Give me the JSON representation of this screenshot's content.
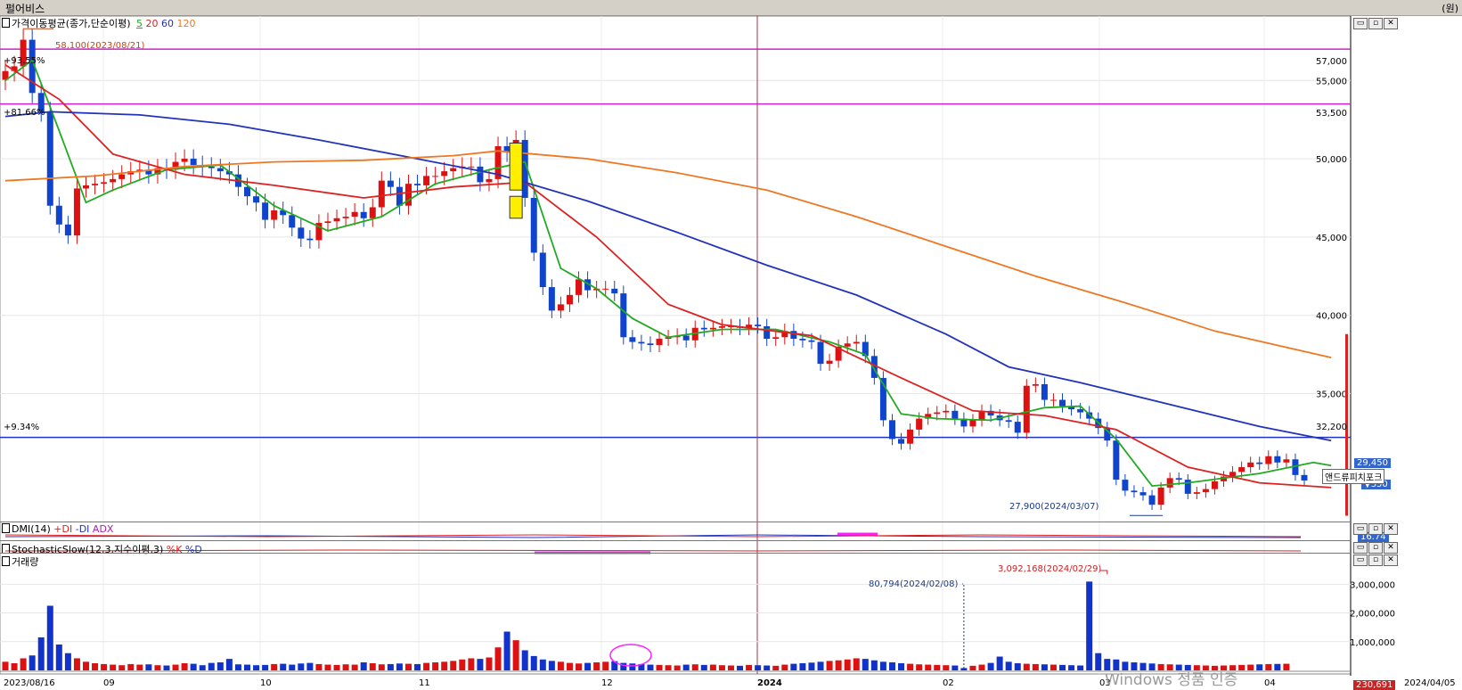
{
  "window": {
    "title": "펄어비스",
    "unit": "(원)"
  },
  "price_panel": {
    "legend_prefix": "가격이동평균(종가,단순이평)",
    "legend_ma": [
      {
        "label": "5",
        "color": "#22aa22"
      },
      {
        "label": "20",
        "color": "#dd2222"
      },
      {
        "label": "60",
        "color": "#2233bb"
      },
      {
        "label": "120",
        "color": "#ee7722"
      }
    ],
    "high_note": "58,100(2023/08/21)",
    "low_note": "27,900(2024/03/07)",
    "pct_labels": [
      "+93.55%",
      "+81.66%",
      "+9.34%"
    ],
    "hline_labels": [
      "57,000",
      "53,500",
      "32,200"
    ],
    "current_price": "29,450",
    "current_change": "▼350",
    "pitchfork_label": "앤드류피치포크"
  },
  "dmi_panel": {
    "title": "DMI(14)",
    "legend": [
      "+DI",
      "-DI",
      "ADX"
    ],
    "value": "16.74"
  },
  "stoch_panel": {
    "title": "StochasticSlow(12,3,지수이평,3)",
    "legend": [
      "%K",
      "%D"
    ]
  },
  "volume_panel": {
    "title": "거래량",
    "peak_note": "3,092,168(2024/02/29)",
    "low_note": "80,794(2024/02/08)",
    "current": "230,691"
  },
  "x_axis_labels": [
    "2023/08/16",
    "09",
    "10",
    "11",
    "12",
    "2024",
    "02",
    "03",
    "04",
    "2024/04/05"
  ],
  "watermark": "Windows 정품 인증",
  "chart_data": [
    {
      "type": "candlestick",
      "title": "가격이동평균(종가,단순이평)",
      "ylim": [
        27000,
        59000
      ],
      "y_ticks": [
        35000,
        40000,
        45000,
        50000,
        55000
      ],
      "y_tick_labels": [
        "35,000",
        "40,000",
        "45,000",
        "50,000",
        "55,000"
      ],
      "hlines": [
        57000,
        53500,
        32200
      ],
      "vline_date": "2024/01/02",
      "close": [
        55600,
        55900,
        57600,
        54200,
        53000,
        47000,
        45800,
        45100,
        48100,
        48300,
        48400,
        48500,
        48700,
        49000,
        49200,
        49300,
        49000,
        49400,
        49300,
        49800,
        50000,
        49600,
        49500,
        49400,
        49200,
        49000,
        48200,
        47600,
        47200,
        46100,
        46700,
        46400,
        45600,
        44900,
        44800,
        45900,
        46000,
        46200,
        46300,
        46600,
        46200,
        46900,
        48600,
        48200,
        47000,
        48400,
        48300,
        48900,
        48900,
        49200,
        49400,
        49500,
        49500,
        48500,
        48700,
        50800,
        50400,
        51200,
        47500,
        44000,
        41800,
        40300,
        40700,
        41300,
        42300,
        41600,
        41700,
        41700,
        41400,
        38600,
        38300,
        38200,
        38100,
        38500,
        38600,
        38700,
        38400,
        39200,
        39100,
        39200,
        39300,
        39300,
        39200,
        39400,
        39300,
        38500,
        38600,
        39000,
        38500,
        38400,
        38300,
        36900,
        37100,
        38000,
        38200,
        38300,
        37400,
        36000,
        33300,
        32100,
        31800,
        32700,
        33400,
        33700,
        33800,
        33900,
        33400,
        32900,
        33300,
        33900,
        33600,
        33300,
        33200,
        32500,
        35500,
        35600,
        34600,
        34600,
        34200,
        34000,
        33800,
        33400,
        32800,
        32000,
        29500,
        28800,
        28700,
        28500,
        27900,
        29000,
        29600,
        29500,
        28600,
        28700,
        28900,
        29400,
        29700,
        30000,
        30300,
        30600,
        30500,
        31000,
        30600,
        30800,
        29800,
        29450
      ],
      "ma": [
        {
          "name": "5",
          "color": "#22aa22",
          "points": [
            [
              0,
              55000
            ],
            [
              3,
              56300
            ],
            [
              6,
              51800
            ],
            [
              9,
              47200
            ],
            [
              12,
              48000
            ],
            [
              18,
              49300
            ],
            [
              24,
              49600
            ],
            [
              30,
              47000
            ],
            [
              36,
              45400
            ],
            [
              42,
              46300
            ],
            [
              48,
              48400
            ],
            [
              54,
              49300
            ],
            [
              58,
              49800
            ],
            [
              62,
              43000
            ],
            [
              66,
              41700
            ],
            [
              70,
              39800
            ],
            [
              74,
              38600
            ],
            [
              80,
              39100
            ],
            [
              86,
              39100
            ],
            [
              92,
              38300
            ],
            [
              96,
              37500
            ],
            [
              100,
              33700
            ],
            [
              104,
              33400
            ],
            [
              110,
              33300
            ],
            [
              116,
              34100
            ],
            [
              120,
              34200
            ],
            [
              124,
              32100
            ],
            [
              128,
              29100
            ],
            [
              132,
              29300
            ],
            [
              140,
              29900
            ],
            [
              146,
              30600
            ],
            [
              148,
              30400
            ]
          ]
        },
        {
          "name": "20",
          "color": "#dd2222",
          "points": [
            [
              0,
              56000
            ],
            [
              6,
              53800
            ],
            [
              12,
              50300
            ],
            [
              20,
              49000
            ],
            [
              30,
              48300
            ],
            [
              40,
              47500
            ],
            [
              50,
              48200
            ],
            [
              58,
              48500
            ],
            [
              66,
              45000
            ],
            [
              74,
              40700
            ],
            [
              80,
              39400
            ],
            [
              90,
              38700
            ],
            [
              100,
              36000
            ],
            [
              108,
              33900
            ],
            [
              116,
              33600
            ],
            [
              124,
              32700
            ],
            [
              132,
              30300
            ],
            [
              140,
              29300
            ],
            [
              148,
              29000
            ]
          ]
        },
        {
          "name": "60",
          "color": "#2233bb",
          "points": [
            [
              0,
              52700
            ],
            [
              5,
              53000
            ],
            [
              15,
              52800
            ],
            [
              25,
              52200
            ],
            [
              35,
              51200
            ],
            [
              45,
              50100
            ],
            [
              55,
              49000
            ],
            [
              65,
              47300
            ],
            [
              75,
              45300
            ],
            [
              85,
              43200
            ],
            [
              95,
              41300
            ],
            [
              105,
              38800
            ],
            [
              112,
              36700
            ],
            [
              120,
              35700
            ],
            [
              130,
              34300
            ],
            [
              140,
              32900
            ],
            [
              148,
              32000
            ]
          ]
        },
        {
          "name": "120",
          "color": "#ee7722",
          "points": [
            [
              0,
              48600
            ],
            [
              10,
              48900
            ],
            [
              20,
              49500
            ],
            [
              30,
              49800
            ],
            [
              40,
              49900
            ],
            [
              50,
              50200
            ],
            [
              55,
              50500
            ],
            [
              65,
              50000
            ],
            [
              75,
              49100
            ],
            [
              85,
              48000
            ],
            [
              95,
              46300
            ],
            [
              105,
              44400
            ],
            [
              115,
              42500
            ],
            [
              125,
              40800
            ],
            [
              135,
              39000
            ],
            [
              148,
              37300
            ]
          ]
        }
      ]
    },
    {
      "type": "bar",
      "title": "거래량",
      "ylim": [
        0,
        3600000
      ],
      "y_ticks": [
        1000000,
        2000000,
        3000000
      ],
      "y_tick_labels": [
        "1,000,000",
        "2,000,000",
        "3,000,000"
      ],
      "values": [
        300000,
        250000,
        420000,
        520000,
        1150000,
        2250000,
        900000,
        600000,
        420000,
        300000,
        250000,
        220000,
        200000,
        180000,
        220000,
        200000,
        210000,
        180000,
        170000,
        200000,
        250000,
        230000,
        180000,
        260000,
        280000,
        400000,
        210000,
        200000,
        180000,
        190000,
        220000,
        230000,
        200000,
        240000,
        260000,
        220000,
        200000,
        190000,
        210000,
        200000,
        280000,
        250000,
        210000,
        220000,
        240000,
        230000,
        220000,
        260000,
        280000,
        300000,
        330000,
        380000,
        420000,
        400000,
        450000,
        800000,
        1350000,
        1050000,
        700000,
        500000,
        380000,
        330000,
        300000,
        260000,
        240000,
        260000,
        280000,
        300000,
        320000,
        260000,
        240000,
        220000,
        200000,
        190000,
        180000,
        170000,
        200000,
        210000,
        190000,
        200000,
        180000,
        170000,
        160000,
        190000,
        180000,
        170000,
        160000,
        200000,
        230000,
        250000,
        270000,
        300000,
        330000,
        350000,
        380000,
        420000,
        400000,
        350000,
        300000,
        280000,
        250000,
        230000,
        210000,
        200000,
        190000,
        180000,
        170000,
        81000,
        160000,
        200000,
        260000,
        480000,
        300000,
        250000,
        230000,
        220000,
        210000,
        200000,
        190000,
        180000,
        170000,
        3092168,
        600000,
        400000,
        380000,
        300000,
        280000,
        260000,
        240000,
        220000,
        210000,
        200000,
        190000,
        180000,
        170000,
        160000,
        170000,
        180000,
        190000,
        200000,
        210000,
        220000,
        225000,
        230691
      ]
    }
  ]
}
